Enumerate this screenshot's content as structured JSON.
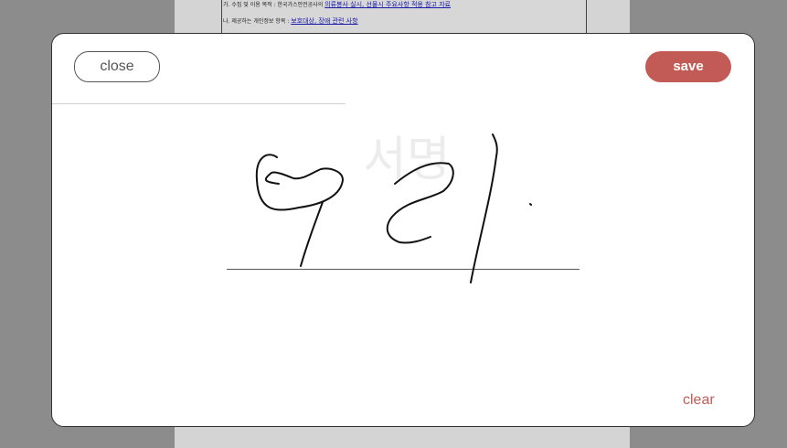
{
  "background_document": {
    "line1_prefix": "가. 수집 및 이용 목적 : 한국가스안전공사의",
    "line1_link": "의류봉사 실시, 선물시 주요사항 적용 참고 자료",
    "line2_prefix": "나. 제공하는 개인정보 항목 :",
    "line2_link": "보호대상, 장애 관련 사항"
  },
  "modal": {
    "close_label": "close",
    "save_label": "save",
    "clear_label": "clear",
    "signature_placeholder": "서명"
  },
  "colors": {
    "accent": "#c25b55",
    "overlay": "#8c8c8c",
    "ink": "#111111"
  }
}
